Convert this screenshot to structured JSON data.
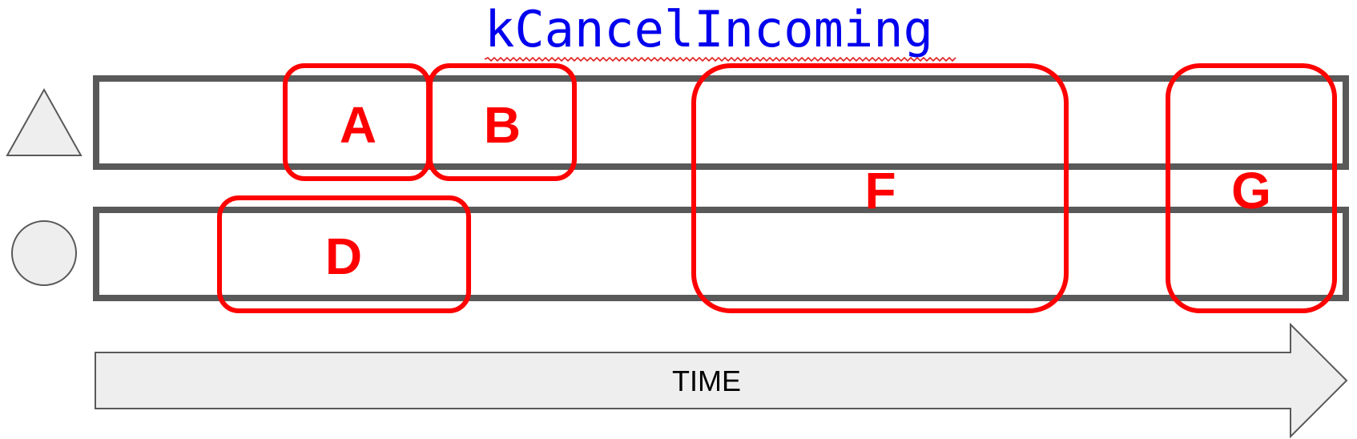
{
  "title": "kCancelIncoming",
  "timeline": {
    "label": "TIME"
  },
  "tracks": [
    {
      "marker": "triangle-icon"
    },
    {
      "marker": "circle-icon"
    }
  ],
  "regions": [
    {
      "id": "A",
      "label": "A"
    },
    {
      "id": "B",
      "label": "B"
    },
    {
      "id": "D",
      "label": "D"
    },
    {
      "id": "F",
      "label": "F"
    },
    {
      "id": "G",
      "label": "G"
    }
  ],
  "colors": {
    "title": "#0000ee",
    "region_stroke": "#ff0000",
    "region_label": "#ff0000",
    "track_stroke": "#595959",
    "shape_fill": "#eeeeee",
    "shape_stroke": "#595959"
  }
}
